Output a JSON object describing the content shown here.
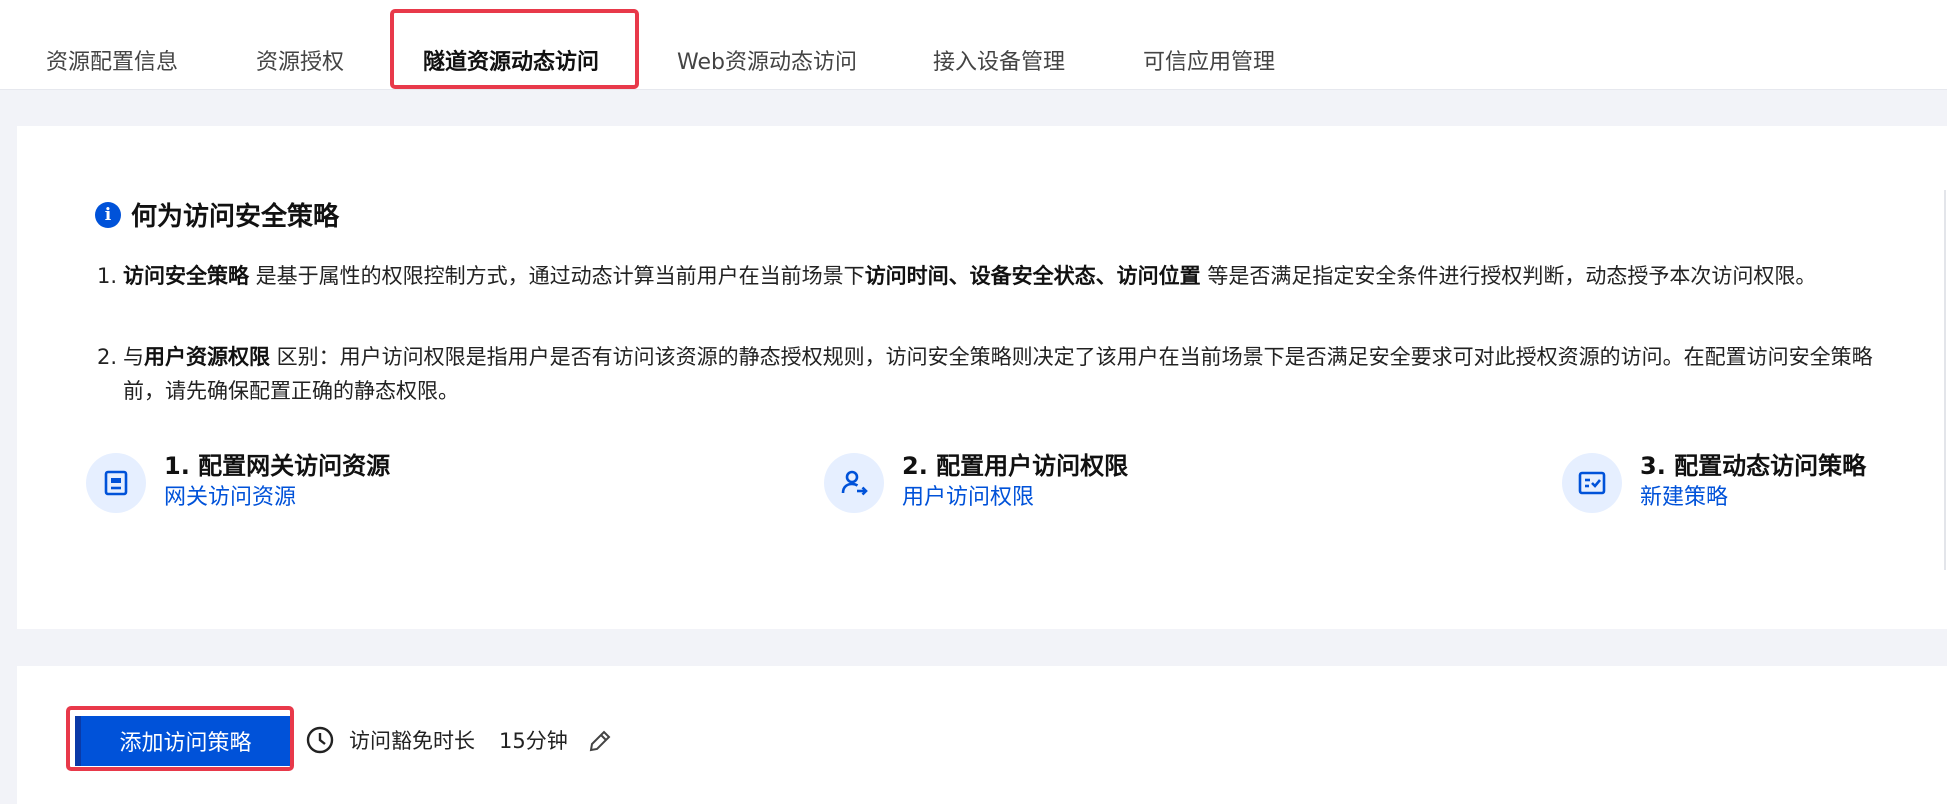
{
  "tabs": [
    {
      "label": "资源配置信息",
      "active": false
    },
    {
      "label": "资源授权",
      "active": false
    },
    {
      "label": "隧道资源动态访问",
      "active": true
    },
    {
      "label": "Web资源动态访问",
      "active": false
    },
    {
      "label": "接入设备管理",
      "active": false
    },
    {
      "label": "可信应用管理",
      "active": false
    }
  ],
  "info": {
    "icon": "info-circle-icon",
    "title": "何为访问安全策略",
    "items": [
      {
        "num": "1.",
        "bold1": "访问安全策略",
        "text1": " 是基于属性的权限控制方式，通过动态计算当前用户在当前场景下",
        "bold2": "访问时间、设备安全状态、访问位置",
        "text2": " 等是否满足指定安全条件进行授权判断，动态授予本次访问权限。"
      },
      {
        "num": "2.",
        "text0": "与",
        "bold1": "用户资源权限",
        "text1": " 区别：用户访问权限是指用户是否有访问该资源的静态授权规则，访问安全策略则决定了该用户在当前场景下是否满足安全要求可对此授权资源的访问。在配置访问安全策略前，请先确保配置正确的静态权限。"
      }
    ]
  },
  "steps": [
    {
      "title": "1. 配置网关访问资源",
      "link": "网关访问资源",
      "icon": "gateway-resource-icon"
    },
    {
      "title": "2. 配置用户访问权限",
      "link": "用户访问权限",
      "icon": "user-permission-icon"
    },
    {
      "title": "3. 配置动态访问策略",
      "link": "新建策略",
      "icon": "policy-check-icon"
    }
  ],
  "actions": {
    "add_button": "添加访问策略",
    "timeout_label": "访问豁免时长",
    "timeout_value": "15分钟",
    "clock_icon": "clock-icon",
    "edit_icon": "pencil-edit-icon"
  },
  "colors": {
    "primary": "#0052d9",
    "highlight": "#e8394a",
    "background": "#f2f3f8"
  }
}
